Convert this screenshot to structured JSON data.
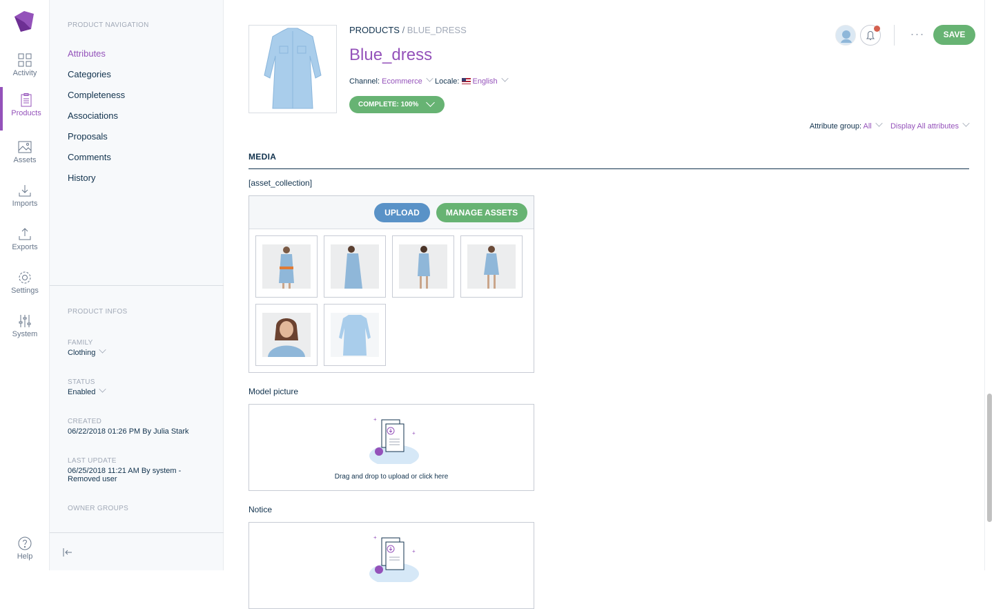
{
  "main_menu": {
    "items": [
      {
        "label": "Activity",
        "icon": "dashboard-icon"
      },
      {
        "label": "Products",
        "icon": "clipboard-icon",
        "active": true
      },
      {
        "label": "Assets",
        "icon": "image-icon"
      },
      {
        "label": "Imports",
        "icon": "import-icon"
      },
      {
        "label": "Exports",
        "icon": "export-icon"
      },
      {
        "label": "Settings",
        "icon": "gear-icon"
      },
      {
        "label": "System",
        "icon": "sliders-icon"
      }
    ],
    "help_label": "Help"
  },
  "product_nav": {
    "title": "PRODUCT NAVIGATION",
    "links": [
      "Attributes",
      "Categories",
      "Completeness",
      "Associations",
      "Proposals",
      "Comments",
      "History"
    ],
    "active_link": "Attributes"
  },
  "product_infos": {
    "title": "PRODUCT INFOS",
    "family_label": "FAMILY",
    "family_value": "Clothing",
    "status_label": "STATUS",
    "status_value": "Enabled",
    "created_label": "CREATED",
    "created_value": "06/22/2018 01:26 PM By Julia Stark",
    "last_update_label": "LAST UPDATE",
    "last_update_line1": "06/25/2018 11:21 AM By system -",
    "last_update_line2": "Removed user",
    "owner_groups_label": "OWNER GROUPS"
  },
  "header": {
    "breadcrumb_root": "PRODUCTS",
    "breadcrumb_sep": " / ",
    "breadcrumb_current": "BLUE_DRESS",
    "title": "Blue_dress",
    "channel_label": "Channel:",
    "channel_value": "Ecommerce",
    "locale_label": "Locale:",
    "locale_value": "English",
    "completeness": "COMPLETE: 100%",
    "save_label": "SAVE",
    "more_label": "···"
  },
  "filters": {
    "attribute_group_label": "Attribute group:",
    "attribute_group_value": "All",
    "display_value": "Display All attributes"
  },
  "media": {
    "section_title": "MEDIA",
    "asset_collection_label": "[asset_collection]",
    "upload_label": "UPLOAD",
    "manage_label": "MANAGE ASSETS",
    "asset_count": 6,
    "model_picture_label": "Model picture",
    "notice_label": "Notice",
    "dropzone_text": "Drag and drop to upload or click here"
  },
  "colors": {
    "accent": "#9452ba",
    "green": "#67b373",
    "blue": "#5992c7",
    "text": "#11324d"
  }
}
